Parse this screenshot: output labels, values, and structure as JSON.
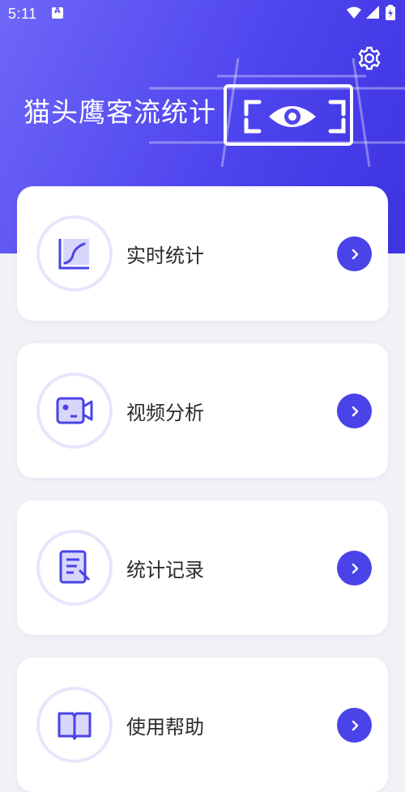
{
  "status_bar": {
    "time": "5:11"
  },
  "header": {
    "title": "猫头鹰客流统计",
    "settings_icon": "gear-icon"
  },
  "colors": {
    "accent": "#4a43e8",
    "hero_gradient_start": "#6e67f7",
    "hero_gradient_end": "#3d33e0",
    "badge_ring": "#e6e6fb"
  },
  "menu": {
    "items": [
      {
        "label": "实时统计",
        "icon": "line-chart-icon"
      },
      {
        "label": "视频分析",
        "icon": "video-camera-icon"
      },
      {
        "label": "统计记录",
        "icon": "document-edit-icon"
      },
      {
        "label": "使用帮助",
        "icon": "help-book-icon"
      }
    ]
  }
}
